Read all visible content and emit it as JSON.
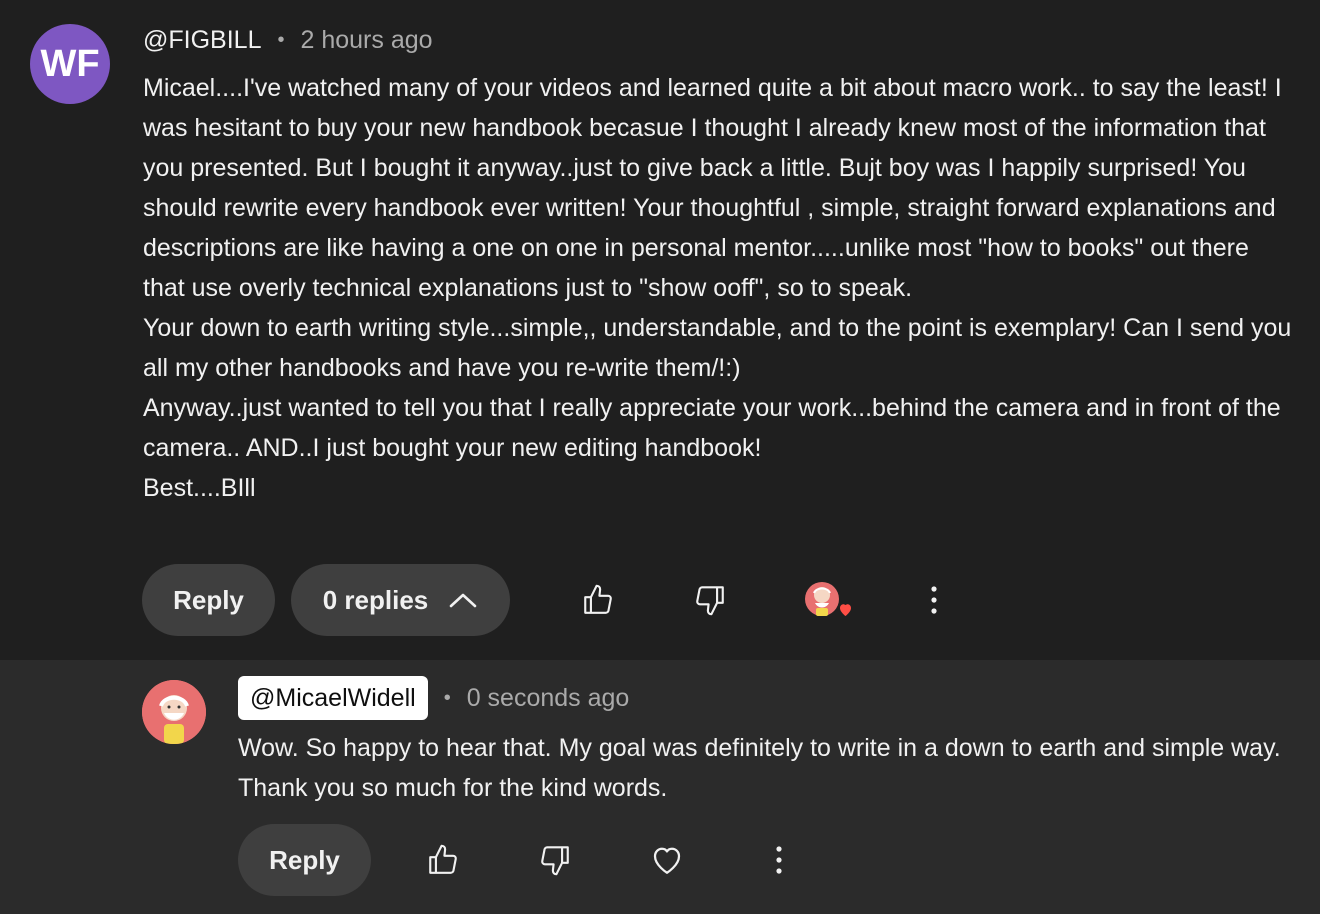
{
  "comment": {
    "avatar_initials": "WF",
    "author": "@FIGBILL",
    "separator": "•",
    "time": "2 hours ago",
    "paragraphs": [
      "Micael....I've watched many of your videos and learned quite a bit about macro work.. to say the least! I was hesitant to buy your new handbook becasue I thought I already knew most of the information that you presented. But I bought it anyway..just to give back a little. Bujt boy was I happily surprised!  You should rewrite every handbook ever written! Your thoughtful , simple, straight forward explanations and descriptions are like having a one on one in personal mentor.....unlike most \"how to books\" out there that use overly technical explanations just to \"show ooff\", so to speak.",
      "Your down to earth writing style...simple,, understandable, and to the point is exemplary! Can I send you all my other handbooks and have you re-write them/!:)",
      "Anyway..just wanted to tell you that I really appreciate your work...behind the camera and in front of the camera.. AND..I just bought your new editing handbook!",
      "Best....BIll"
    ],
    "actions": {
      "reply_label": "Reply",
      "replies_label": "0 replies"
    }
  },
  "reply": {
    "author": "@MicaelWidell",
    "separator": "•",
    "time": "0 seconds ago",
    "text": "Wow. So happy to hear that. My goal was definitely to write in a down to earth and simple way. Thank you so much for the kind words.",
    "actions": {
      "reply_label": "Reply"
    }
  },
  "icons": {
    "like": "thumbs-up-icon",
    "dislike": "thumbs-down-icon",
    "creator_heart": "creator-heart-badge",
    "heart": "heart-icon",
    "more": "more-vertical-icon",
    "collapse": "chevron-up-icon"
  },
  "colors": {
    "background": "#1f1f1f",
    "reply_background": "#2b2b2b",
    "pill": "#3f3f3f",
    "avatar_wf": "#7e57c2",
    "heart_red": "#ff4e45",
    "muted_text": "#aaaaaa"
  }
}
